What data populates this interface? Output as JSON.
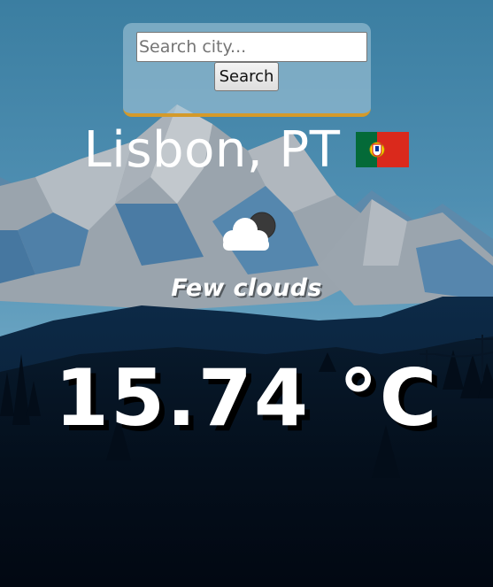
{
  "search": {
    "placeholder": "Search city...",
    "button_label": "Search"
  },
  "weather": {
    "city": "Lisbon, PT",
    "country_flag": "portugal-flag",
    "condition_icon": "few-clouds-icon",
    "description": "Few clouds",
    "temperature": "15.74 °C"
  },
  "colors": {
    "panel_accent": "#d49a2a",
    "text": "#ffffff",
    "flag_green": "#046a38",
    "flag_red": "#da291c"
  }
}
